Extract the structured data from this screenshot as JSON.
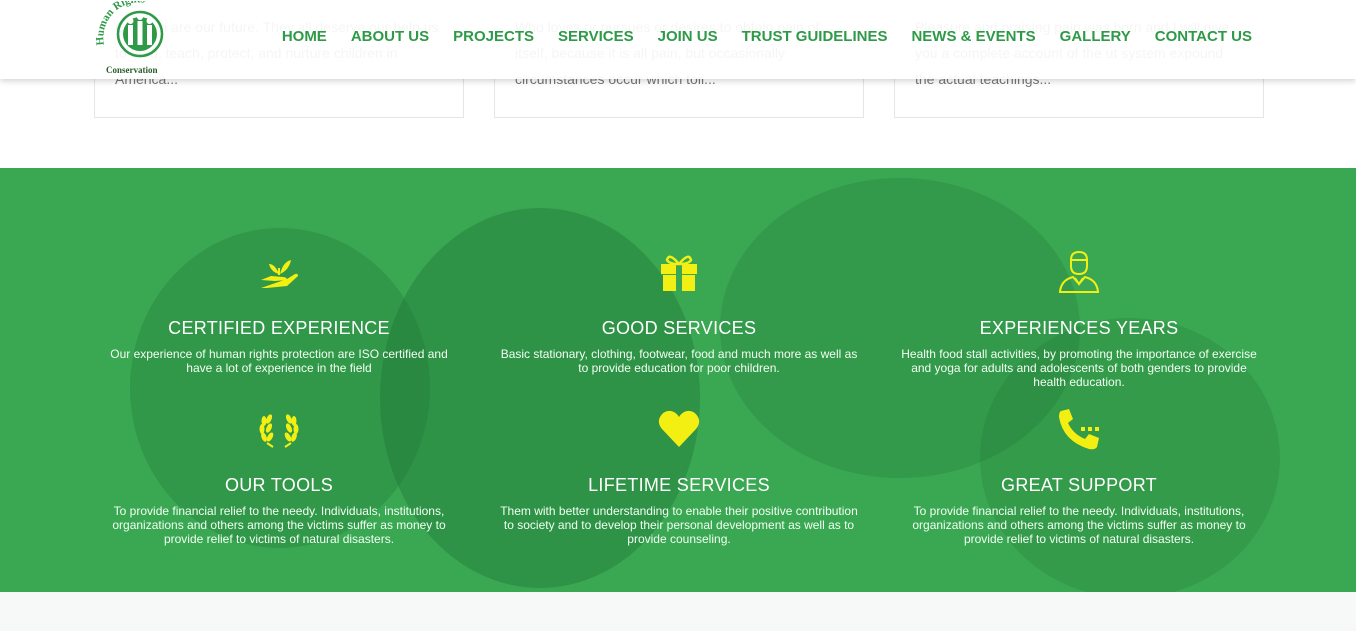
{
  "cards": [
    {
      "text": "Children are our future. They all deserve our help us to feed, teach, protect, and nurture children in America..."
    },
    {
      "text": "Who loves or pursues or desires to obtain pain of itself, because it is all pain, but occasionally circumstances occur which toil..."
    },
    {
      "text": "Pleasure and praising pain was born and I will give you a complete account of the ut system expound the actual teachings..."
    }
  ],
  "logo": {
    "text_arc": "Human Rights",
    "subtitle": "Conservation"
  },
  "nav": {
    "items": [
      "HOME",
      "ABOUT US",
      "PROJECTS",
      "SERVICES",
      "JOIN US",
      "TRUST GUIDELINES",
      "NEWS & EVENTS",
      "GALLERY",
      "CONTACT US"
    ]
  },
  "colors": {
    "brand_green": "#2e9a47",
    "section_green": "#3aa853",
    "icon_yellow": "#f4ef13"
  },
  "features": [
    {
      "icon": "hand-plant-icon",
      "title": "CERTIFIED EXPERIENCE",
      "text": "Our experience of human rights protection are ISO certified and have a lot of experience in the field"
    },
    {
      "icon": "gift-icon",
      "title": "GOOD SERVICES",
      "text": "Basic stationary, clothing, footwear, food and much more as well as to provide education for poor children."
    },
    {
      "icon": "doctor-icon",
      "title": "EXPERIENCES YEARS",
      "text": "Health food stall activities, by promoting the importance of exercise and yoga for adults and adolescents of both genders to provide health education."
    },
    {
      "icon": "laurel-icon",
      "title": "OUR TOOLS",
      "text": "To provide financial relief to the needy. Individuals, institutions, organizations and others among the victims suffer as money to provide relief to victims of natural disasters."
    },
    {
      "icon": "heart-icon",
      "title": "LIFETIME SERVICES",
      "text": "Them with better understanding to enable their positive contribution to society and to develop their personal development as well as to provide counseling."
    },
    {
      "icon": "phone-icon",
      "title": "GREAT SUPPORT",
      "text": "To provide financial relief to the needy. Individuals, institutions, organizations and others among the victims suffer as money to provide relief to victims of natural disasters."
    }
  ]
}
